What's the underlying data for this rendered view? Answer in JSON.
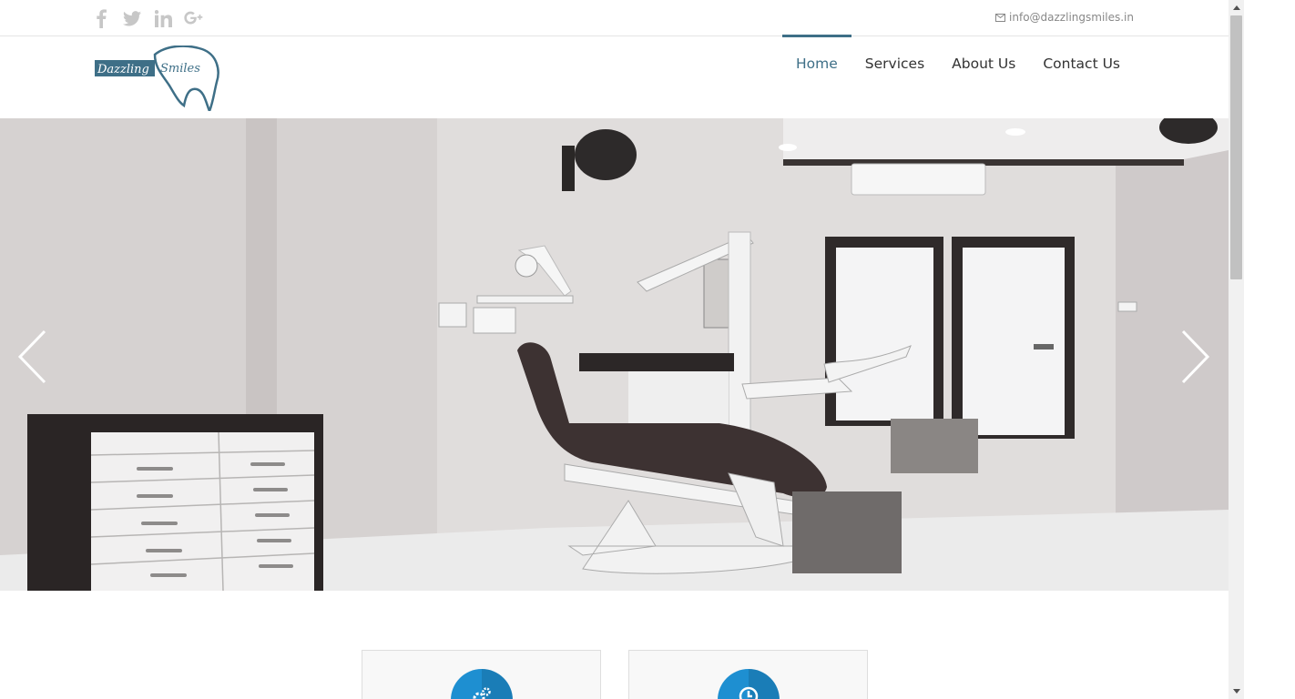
{
  "topbar": {
    "social": [
      {
        "icon": "facebook-icon"
      },
      {
        "icon": "twitter-icon"
      },
      {
        "icon": "linkedin-icon"
      },
      {
        "icon": "google-plus-icon"
      }
    ],
    "email": "info@dazzlingsmiles.in"
  },
  "header": {
    "logo_left": "Dazzling",
    "logo_right": "Smiles",
    "nav": [
      {
        "label": "Home",
        "active": true
      },
      {
        "label": "Services",
        "active": false
      },
      {
        "label": "About Us",
        "active": false
      },
      {
        "label": "Contact Us",
        "active": false
      }
    ]
  },
  "hero": {
    "prev_icon": "chevron-left-icon",
    "next_icon": "chevron-right-icon"
  },
  "cards": [
    {
      "icon": "gears-icon"
    },
    {
      "icon": "clock-icon"
    }
  ],
  "colors": {
    "accent": "#3e6f87",
    "circle": "#1e8fd1",
    "social": "#c7c7c7"
  }
}
